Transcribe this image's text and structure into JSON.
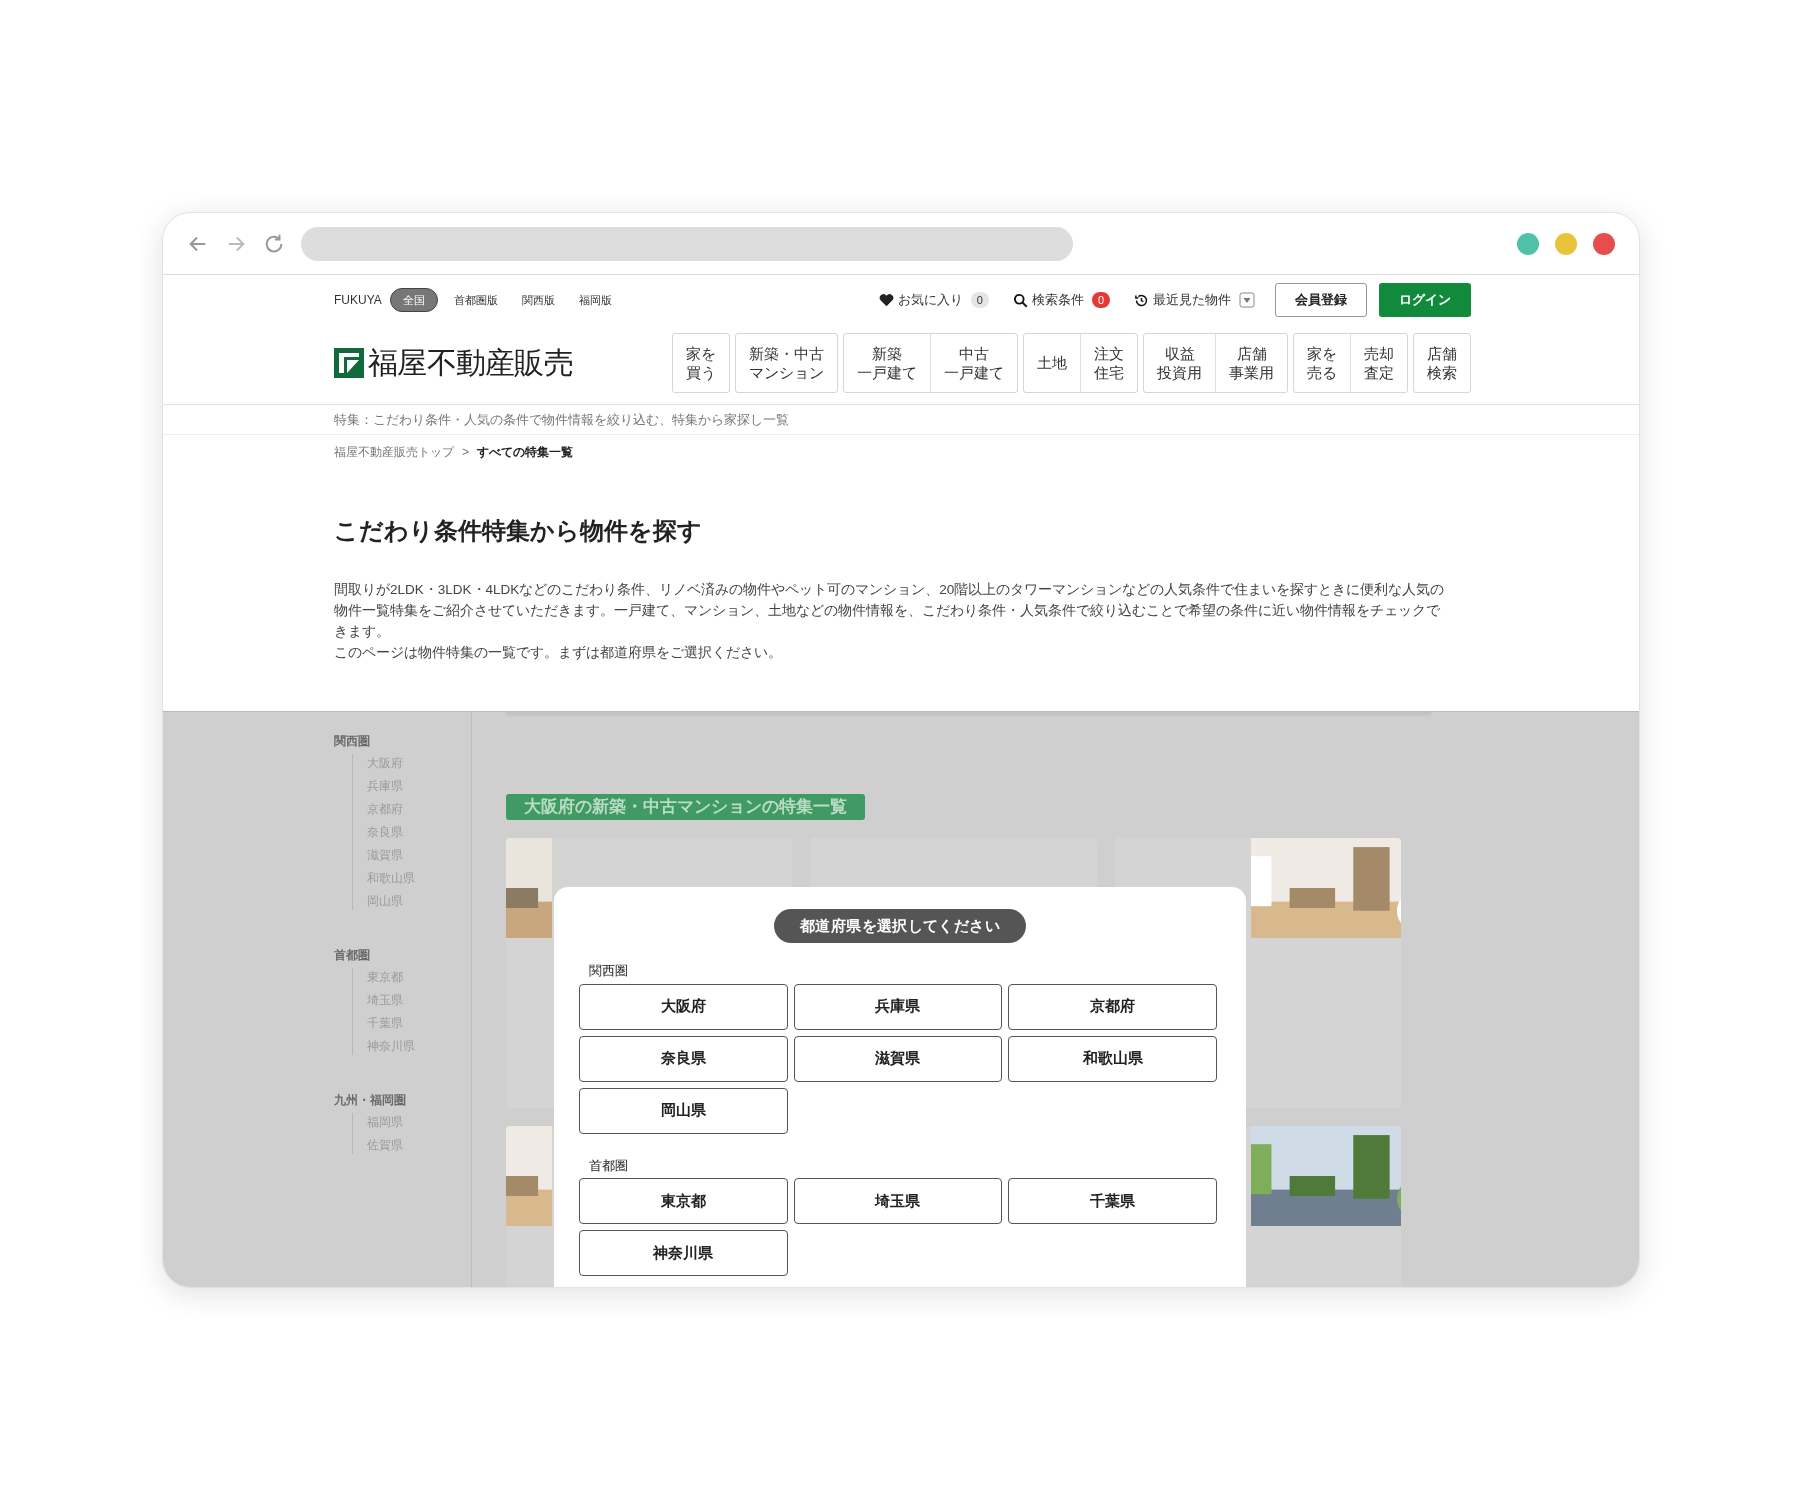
{
  "top_bar": {
    "brand": "FUKUYA",
    "editions": [
      {
        "label": "全国",
        "selected": true
      },
      {
        "label": "首都圏版",
        "selected": false
      },
      {
        "label": "関西版",
        "selected": false
      },
      {
        "label": "福岡版",
        "selected": false
      }
    ],
    "favorites": {
      "label": "お気に入り",
      "count": "0"
    },
    "saved_searches": {
      "label": "検索条件",
      "count": "0"
    },
    "recently_viewed": {
      "label": "最近見た物件"
    },
    "register": "会員登録",
    "login": "ログイン"
  },
  "logo": {
    "text": "福屋不動産販売"
  },
  "nav": [
    [
      [
        "家を",
        "買う"
      ]
    ],
    [
      [
        "新築・中古",
        "マンション"
      ]
    ],
    [
      [
        "新築",
        "一戸建て"
      ],
      [
        "中古",
        "一戸建て"
      ]
    ],
    [
      [
        "土地"
      ],
      [
        "注文",
        "住宅"
      ]
    ],
    [
      [
        "収益",
        "投資用"
      ],
      [
        "店舗",
        "事業用"
      ]
    ],
    [
      [
        "家を",
        "売る"
      ],
      [
        "売却",
        "査定"
      ]
    ],
    [
      [
        "店舗",
        "検索"
      ]
    ]
  ],
  "page_caption": "特集：こだわり条件・人気の条件で物件情報を絞り込む、特集から家探し一覧",
  "breadcrumb": [
    {
      "label": "福屋不動産販売トップ",
      "current": false
    },
    {
      "label": ">",
      "current": false
    },
    {
      "label": "すべての特集一覧",
      "current": true
    }
  ],
  "heading": "こだわり条件特集から物件を探す",
  "paragraphs": [
    "間取りが2LDK・3LDK・4LDKなどのこだわり条件、リノベ済みの物件やペット可のマンション、20階以上のタワーマンションなどの人気条件で住まいを探すときに便利な人気の物件一覧特集をご紹介させていただきます。一戸建て、マンション、土地などの物件情報を、こだわり条件・人気条件で絞り込むことで希望の条件に近い物件情報をチェックできます。",
    "このページは物件特集の一覧です。まずは都道府県をご選択ください。"
  ],
  "sidebar": [
    {
      "name": "関西圏",
      "children": [
        "大阪府",
        "兵庫県",
        "京都府",
        "奈良県",
        "滋賀県",
        "和歌山県",
        "岡山県"
      ]
    },
    {
      "name": "首都圏",
      "children": [
        "東京都",
        "埼玉県",
        "千葉県",
        "神奈川県"
      ]
    },
    {
      "name": "九州・福岡圏",
      "children": [
        "福岡県",
        "佐賀県"
      ]
    }
  ],
  "banner": "大阪府の新築・中古マンションの特集一覧",
  "modal": {
    "title": "都道府県を選択してください",
    "groups": [
      {
        "name": "関西圏",
        "prefectures": [
          "大阪府",
          "兵庫県",
          "京都府",
          "奈良県",
          "滋賀県",
          "和歌山県",
          "岡山県"
        ]
      },
      {
        "name": "首都圏",
        "prefectures": [
          "東京都",
          "埼玉県",
          "千葉県",
          "神奈川県"
        ]
      }
    ]
  }
}
